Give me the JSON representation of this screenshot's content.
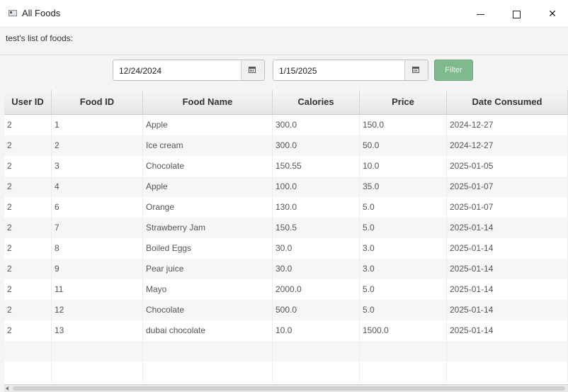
{
  "window": {
    "title": "All Foods",
    "close_glyph": "✕"
  },
  "header": {
    "label": "test's list of foods:"
  },
  "filter": {
    "start_date": "12/24/2024",
    "end_date": "1/15/2025",
    "button_label": "Filter"
  },
  "table": {
    "columns": [
      "User ID",
      "Food ID",
      "Food Name",
      "Calories",
      "Price",
      "Date Consumed"
    ],
    "rows": [
      [
        "2",
        "1",
        "Apple",
        "300.0",
        "150.0",
        "2024-12-27"
      ],
      [
        "2",
        "2",
        "Ice cream",
        "300.0",
        "50.0",
        "2024-12-27"
      ],
      [
        "2",
        "3",
        "Chocolate",
        "150.55",
        "10.0",
        "2025-01-05"
      ],
      [
        "2",
        "4",
        "Apple",
        "100.0",
        "35.0",
        "2025-01-07"
      ],
      [
        "2",
        "6",
        "Orange",
        "130.0",
        "5.0",
        "2025-01-07"
      ],
      [
        "2",
        "7",
        "Strawberry Jam",
        "150.5",
        "5.0",
        "2025-01-14"
      ],
      [
        "2",
        "8",
        "Boiled Eggs",
        "30.0",
        "3.0",
        "2025-01-14"
      ],
      [
        "2",
        "9",
        "Pear juice",
        "30.0",
        "3.0",
        "2025-01-14"
      ],
      [
        "2",
        "11",
        "Mayo",
        "2000.0",
        "5.0",
        "2025-01-14"
      ],
      [
        "2",
        "12",
        "Chocolate",
        "500.0",
        "5.0",
        "2025-01-14"
      ],
      [
        "2",
        "13",
        "dubai chocolate",
        "10.0",
        "1500.0",
        "2025-01-14"
      ]
    ]
  }
}
